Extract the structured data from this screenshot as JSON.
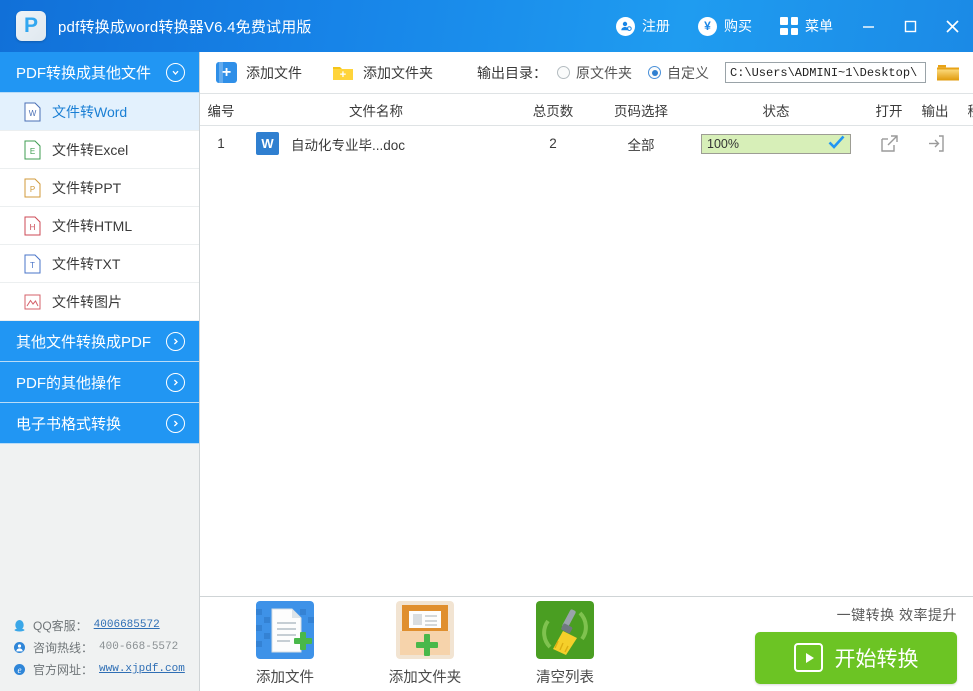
{
  "titlebar": {
    "app_title": "pdf转换成word转换器V6.4免费试用版",
    "logo_letter": "P",
    "register_label": "注册",
    "buy_label": "购买",
    "menu_label": "菜单",
    "yen_symbol": "¥",
    "accent_color": "#1f8ae8"
  },
  "sidebar": {
    "groups": [
      {
        "label": "PDF转换成其他文件",
        "expanded": true,
        "icon": "chevron-down-icon"
      },
      {
        "label": "其他文件转换成PDF",
        "expanded": false,
        "icon": "chevron-right-icon"
      },
      {
        "label": "PDF的其他操作",
        "expanded": false,
        "icon": "chevron-right-icon"
      },
      {
        "label": "电子书格式转换",
        "expanded": false,
        "icon": "chevron-right-icon"
      }
    ],
    "items": [
      {
        "label": "文件转Word",
        "letter": "W",
        "color": "#4a6fb5",
        "active": true
      },
      {
        "label": "文件转Excel",
        "letter": "E",
        "color": "#3f9c51",
        "active": false
      },
      {
        "label": "文件转PPT",
        "letter": "P",
        "color": "#d09a3a",
        "active": false
      },
      {
        "label": "文件转HTML",
        "letter": "H",
        "color": "#cc4a55",
        "active": false
      },
      {
        "label": "文件转TXT",
        "letter": "T",
        "color": "#4a74c8",
        "active": false
      },
      {
        "label": "文件转图片",
        "letter": "",
        "color": "#d4606a",
        "active": false
      }
    ],
    "contact": {
      "qq_label": "QQ客服：",
      "qq_value": "4006685572",
      "hotline_label": "咨询热线：",
      "hotline_value": "400-668-5572",
      "site_label": "官方网址：",
      "site_value": "www.xjpdf.com"
    }
  },
  "toolbar": {
    "add_file_label": "添加文件",
    "add_folder_label": "添加文件夹",
    "output_dir_label": "输出目录：",
    "radio_source_label": "原文件夹",
    "radio_custom_label": "自定义",
    "selected_radio": "自定义",
    "path_value": "C:\\Users\\ADMINI~1\\Desktop\\",
    "browse_icon": "folder-icon"
  },
  "table": {
    "headers": {
      "no": "编号",
      "name": "文件名称",
      "pages": "总页数",
      "page_select": "页码选择",
      "status": "状态",
      "open": "打开",
      "output": "输出",
      "remove": "移除"
    },
    "rows": [
      {
        "no": "1",
        "file_icon_letter": "W",
        "name": "自动化专业毕...doc",
        "pages": "2",
        "page_select": "全部",
        "progress_text": "100%",
        "progress_percent": 100,
        "status_done": true
      }
    ]
  },
  "footer": {
    "buttons": [
      {
        "label": "添加文件",
        "icon": "add-file-icon"
      },
      {
        "label": "添加文件夹",
        "icon": "add-folder-icon"
      },
      {
        "label": "清空列表",
        "icon": "clear-list-icon"
      }
    ],
    "tagline": "一键转换 效率提升",
    "start_label": "开始转换",
    "start_color": "#6cc424"
  }
}
